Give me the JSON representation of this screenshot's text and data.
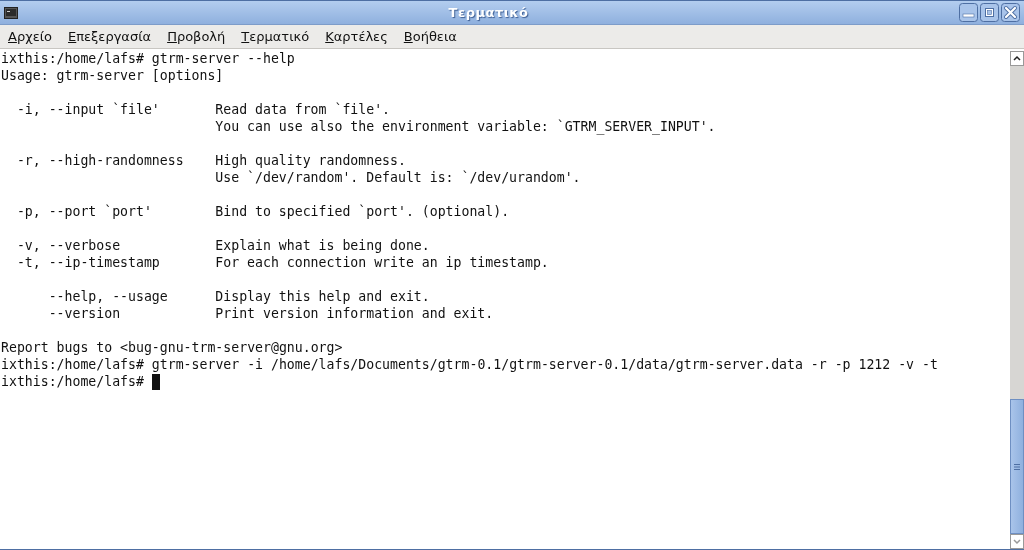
{
  "window": {
    "title": "Τερματικό"
  },
  "menu": [
    {
      "label": "Αρχείο"
    },
    {
      "label": "Επεξεργασία"
    },
    {
      "label": "Προβολή"
    },
    {
      "label": "Τερματικό"
    },
    {
      "label": "Καρτέλες"
    },
    {
      "label": "Βοήθεια"
    }
  ],
  "terminal": {
    "lines": [
      {
        "kind": "prompt",
        "prompt": "ixthis:/home/lafs#",
        "command": "gtrm-server --help"
      },
      {
        "kind": "text",
        "text": "Usage: gtrm-server [options]"
      },
      {
        "kind": "blank"
      },
      {
        "kind": "option",
        "short": "-i,",
        "long": "--input `file'",
        "description": [
          "Read data from `file'.",
          "You can use also the environment variable: `GTRM_SERVER_INPUT'."
        ]
      },
      {
        "kind": "blank"
      },
      {
        "kind": "option",
        "short": "-r,",
        "long": "--high-randomness",
        "description": [
          "High quality randomness.",
          "Use `/dev/random'. Default is: `/dev/urandom'."
        ]
      },
      {
        "kind": "blank"
      },
      {
        "kind": "option",
        "short": "-p,",
        "long": "--port `port'",
        "description": [
          "Bind to specified `port'. (optional)."
        ]
      },
      {
        "kind": "blank"
      },
      {
        "kind": "option",
        "short": "-v,",
        "long": "--verbose",
        "description": [
          "Explain what is being done."
        ]
      },
      {
        "kind": "option",
        "short": "-t,",
        "long": "--ip-timestamp",
        "description": [
          "For each connection write an ip timestamp."
        ]
      },
      {
        "kind": "blank"
      },
      {
        "kind": "option",
        "long": "--help, --usage",
        "description": [
          "Display this help and exit."
        ]
      },
      {
        "kind": "option",
        "long": "--version",
        "description": [
          "Print version information and exit."
        ]
      },
      {
        "kind": "blank"
      },
      {
        "kind": "text",
        "text": "Report bugs to <bug-gnu-trm-server@gnu.org>"
      },
      {
        "kind": "prompt",
        "prompt": "ixthis:/home/lafs#",
        "command": "gtrm-server -i /home/lafs/Documents/gtrm-0.1/gtrm-server-0.1/data/gtrm-server.data -r -p 1212 -v -t"
      },
      {
        "kind": "prompt",
        "prompt": "ixthis:/home/lafs#",
        "cursor": true
      }
    ]
  }
}
